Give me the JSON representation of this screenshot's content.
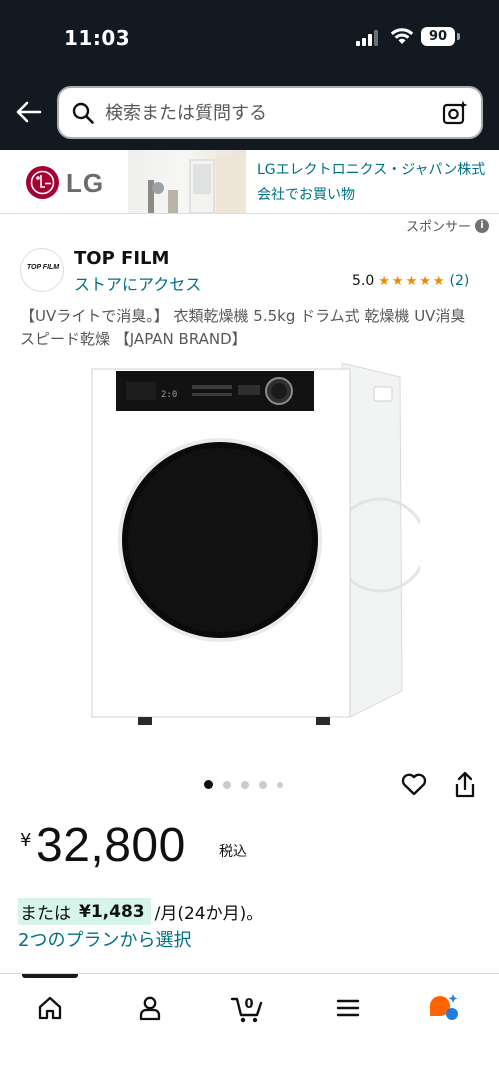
{
  "status_bar": {
    "time": "11:03",
    "battery": "90"
  },
  "search": {
    "placeholder": "検索または質問する"
  },
  "ad_banner": {
    "brand": "LG",
    "text": "LGエレクトロニクス・ジャパン株式会社でお買い物",
    "brand_color": "#a50034"
  },
  "sponsored_label": "スポンサー",
  "store": {
    "logo_text": "TOP FILM",
    "name": "TOP FILM",
    "link": "ストアにアクセス",
    "rating": "5.0",
    "stars": 5,
    "rating_count": "(2)"
  },
  "product": {
    "title": "【UVライトで消臭。】 衣類乾燥機 5.5kg ドラム式 乾燥機 UV消臭 スピード乾燥 【JAPAN BRAND】",
    "image_count": 5,
    "current_image": 1
  },
  "price": {
    "currency": "¥",
    "amount": "32,800",
    "tax_label": "税込"
  },
  "installment": {
    "prefix": "または",
    "amount": "¥1,483",
    "suffix": "/月(24か月)。",
    "plan_link": "2つのプランから選択"
  },
  "bottom_nav": {
    "items": [
      "home-icon",
      "account-icon",
      "cart-icon",
      "menu-icon",
      "rufus-icon"
    ],
    "cart_count": "0",
    "accent": "#ff6200"
  },
  "colors": {
    "header_bg": "#131921",
    "link": "#007185",
    "star": "#f08804",
    "installment_bg": "#d6f5e8"
  }
}
